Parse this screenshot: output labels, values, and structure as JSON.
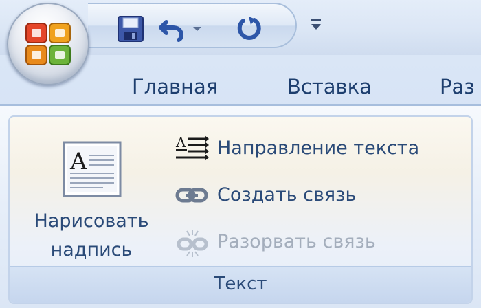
{
  "office_button": {
    "icon": "office-logo-icon"
  },
  "quick_access": {
    "save": {
      "icon": "save-icon"
    },
    "undo": {
      "icon": "undo-icon",
      "dropdown_icon": "chevron-down-icon"
    },
    "redo": {
      "icon": "redo-icon"
    },
    "customize": {
      "icon": "customize-qat-icon"
    }
  },
  "tabs": [
    {
      "label": "Главная"
    },
    {
      "label": "Вставка"
    },
    {
      "label": "Раз"
    }
  ],
  "ribbon": {
    "group": {
      "title": "Текст",
      "draw_textbox": {
        "label_line1": "Нарисовать",
        "label_line2": "надпись",
        "icon": "textbox-icon"
      },
      "text_direction": {
        "label": "Направление текста",
        "icon": "text-direction-icon",
        "enabled": true
      },
      "create_link": {
        "label": "Создать связь",
        "icon": "link-icon",
        "enabled": true
      },
      "break_link": {
        "label": "Разорвать связь",
        "icon": "break-link-icon",
        "enabled": false
      }
    }
  },
  "colors": {
    "label_text": "#2a4a78",
    "disabled_text": "#a4aebc",
    "tab_text": "#1d3e6e"
  }
}
